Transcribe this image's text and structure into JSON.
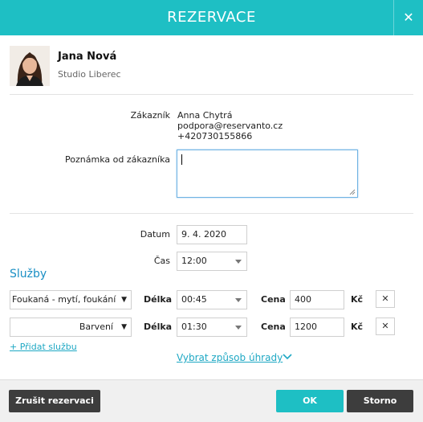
{
  "dialog": {
    "title": "REZERVACE",
    "close_symbol": "✕"
  },
  "employee": {
    "name": "Jana Nová",
    "studio": "Studio Liberec"
  },
  "customer": {
    "label": "Zákazník",
    "name": "Anna Chytrá",
    "email": "podpora@reservanto.cz",
    "phone": "+420730155866"
  },
  "note": {
    "label": "Poznámka od zákazníka",
    "value": ""
  },
  "date": {
    "label": "Datum",
    "value": "9. 4. 2020"
  },
  "time": {
    "label": "Čas",
    "value": "12:00"
  },
  "services": {
    "heading": "Služby",
    "duration_label": "Délka",
    "price_label": "Cena",
    "currency": "Kč",
    "remove_symbol": "✕",
    "rows": [
      {
        "service": "Foukaná - mytí, foukání",
        "duration": "00:45",
        "price": "400"
      },
      {
        "service": "Barvení",
        "duration": "01:30",
        "price": "1200"
      }
    ],
    "add_label": "+ Přidat službu"
  },
  "payment": {
    "label": "Vybrat způsob úhrady"
  },
  "footer": {
    "cancel_reservation": "Zrušit rezervaci",
    "ok": "OK",
    "storno": "Storno"
  },
  "colors": {
    "header": "#1ebfc4",
    "ok_button": "#1ebfc4",
    "dark_button": "#3d3d3d",
    "link": "#1ea8c4",
    "services_heading": "#1a8fc4"
  }
}
